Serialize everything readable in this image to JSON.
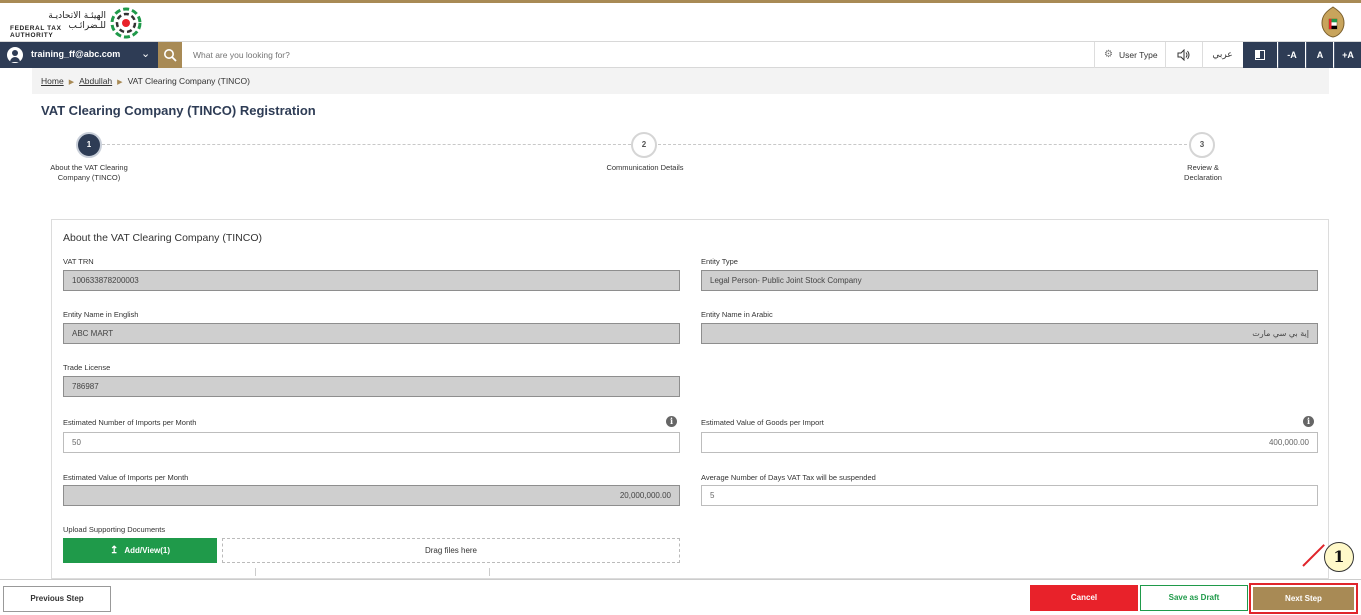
{
  "header": {
    "logo_ar": "الهيئـة الاتحاديـة للـضرائـب",
    "logo_en": "FEDERAL TAX AUTHORITY"
  },
  "navbar": {
    "username": "training_ff@abc.com",
    "search_placeholder": "What are you looking for?",
    "user_type_label": "User Type",
    "language_label": "عربي",
    "font_decrease": "-A",
    "font_normal": "A",
    "font_increase": "+A"
  },
  "breadcrumb": {
    "home": "Home",
    "level2": "Abdullah",
    "current": "VAT Clearing Company (TINCO)"
  },
  "page_title": "VAT Clearing Company (TINCO) Registration",
  "steps": [
    {
      "num": "1",
      "label": "About the VAT Clearing Company (TINCO)",
      "state": "active"
    },
    {
      "num": "2",
      "label": "Communication Details",
      "state": "inactive"
    },
    {
      "num": "3",
      "label": "Review & Declaration",
      "state": "inactive"
    }
  ],
  "form": {
    "section_title": "About the VAT Clearing Company (TINCO)",
    "vat_trn_label": "VAT TRN",
    "vat_trn_value": "100633878200003",
    "entity_type_label": "Entity Type",
    "entity_type_value": "Legal Person- Public Joint Stock Company",
    "entity_name_en_label": "Entity Name in English",
    "entity_name_en_value": "ABC MART",
    "entity_name_ar_label": "Entity Name in Arabic",
    "entity_name_ar_value": "إية بي سي مارت",
    "trade_license_label": "Trade License",
    "trade_license_value": "786987",
    "est_imports_label": "Estimated Number of Imports per Month",
    "est_imports_value": "50",
    "est_goods_value_label": "Estimated Value of Goods per Import",
    "est_goods_value_value": "400,000.00",
    "est_value_imports_label": "Estimated Value of Imports per Month",
    "est_value_imports_value": "20,000,000.00",
    "avg_days_label": "Average Number of Days VAT Tax will be suspended",
    "avg_days_value": "5",
    "upload_label": "Upload Supporting Documents",
    "add_view_label": "Add/View(1)",
    "dropzone_label": "Drag files here"
  },
  "footer": {
    "previous": "Previous Step",
    "cancel": "Cancel",
    "save_draft": "Save as Draft",
    "next": "Next Step"
  },
  "callout_number": "1",
  "colors": {
    "navy": "#2e3c55",
    "gold": "#a88a55",
    "green": "#1f9a4a",
    "red": "#e8222a"
  }
}
